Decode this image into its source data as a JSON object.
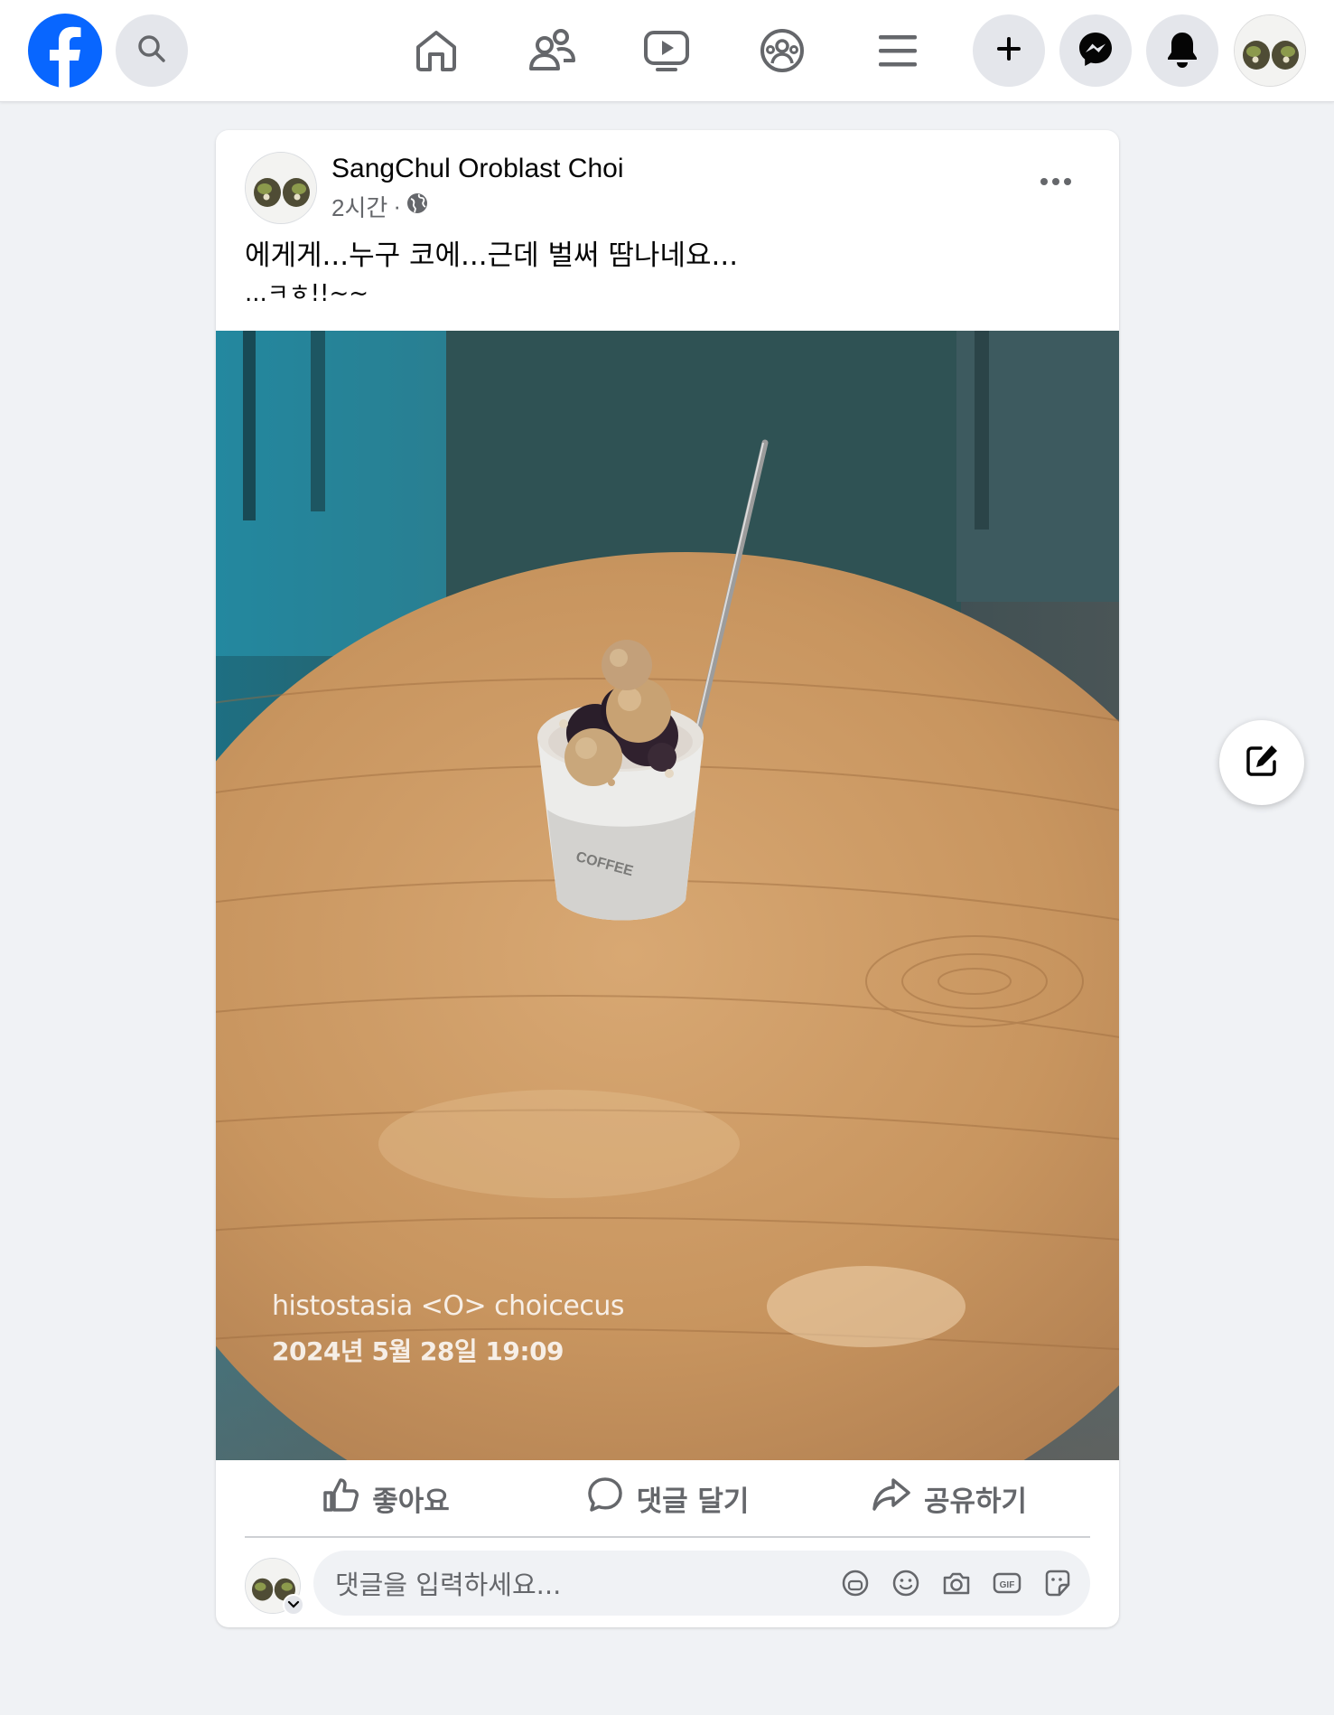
{
  "topbar": {
    "logo": "facebook-logo",
    "icons": [
      "search-icon",
      "home-icon",
      "friends-icon",
      "video-icon",
      "groups-icon",
      "menu-icon",
      "plus-icon",
      "messenger-icon",
      "bell-icon"
    ]
  },
  "post": {
    "author": "SangChul Oroblast Choi",
    "time": "2시간",
    "separator": "·",
    "audience_icon": "globe-icon",
    "text_line1": "에게게...누구 코에...근데 벌써 땀나네요...",
    "text_line2": "...ㅋㅎ!!~~",
    "photo": {
      "watermark_line1": "histostasia <O> choicecus",
      "watermark_line2": "2024년 5월 28일 19:09",
      "cup_text": "COFFEE"
    },
    "actions": {
      "like_label": "좋아요",
      "comment_label": "댓글 달기",
      "share_label": "공유하기"
    },
    "comment_placeholder": "댓글을 입력하세요..."
  },
  "colors": {
    "brand": "#0866ff",
    "background": "#f0f2f5",
    "secondary_text": "#65676b"
  }
}
